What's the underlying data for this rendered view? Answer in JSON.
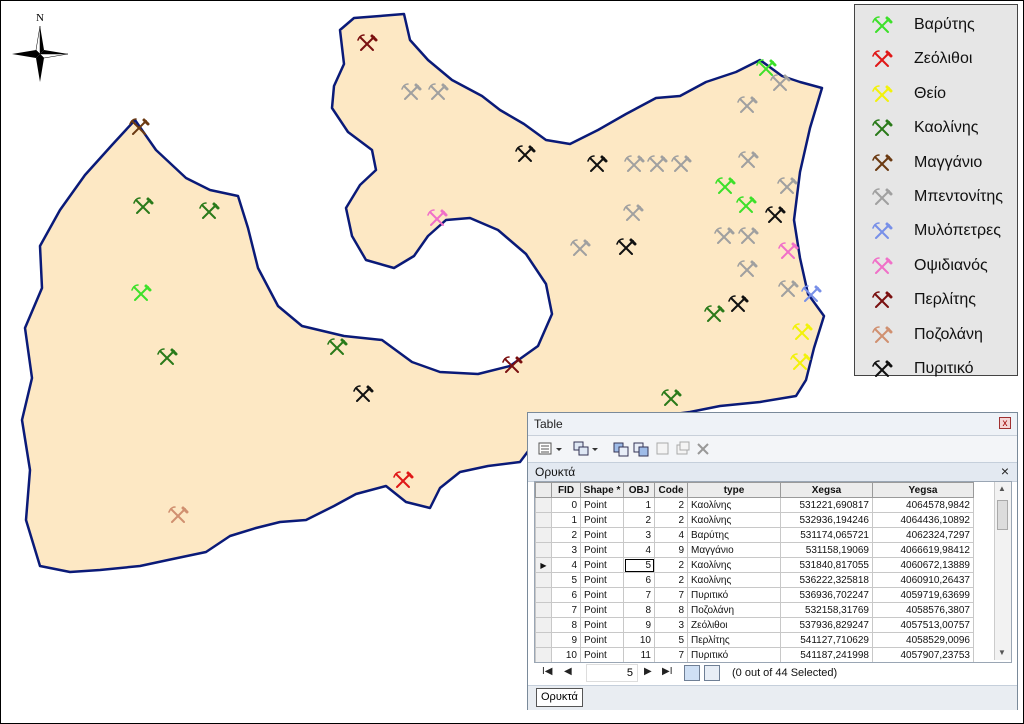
{
  "north_arrow": {
    "label": "N"
  },
  "legend": {
    "items": [
      {
        "label": "Βαρύτης",
        "color": "#3de02a"
      },
      {
        "label": "Ζεόλιθοι",
        "color": "#e01818"
      },
      {
        "label": "Θείο",
        "color": "#f2f20a"
      },
      {
        "label": "Καολίνης",
        "color": "#2a7a1a"
      },
      {
        "label": "Μαγγάνιο",
        "color": "#6b3a12"
      },
      {
        "label": "Μπεντονίτης",
        "color": "#a0a0a0"
      },
      {
        "label": "Μυλόπετρες",
        "color": "#7890e8"
      },
      {
        "label": "Οψιδιανός",
        "color": "#f070c8"
      },
      {
        "label": "Περλίτης",
        "color": "#7a1010"
      },
      {
        "label": "Ποζολάνη",
        "color": "#d09070"
      },
      {
        "label": "Πυριτικό",
        "color": "#111111"
      }
    ]
  },
  "map": {
    "land_color": "#fde8c4",
    "border_color": "#0a1a78"
  },
  "table": {
    "window_title": "Table",
    "close_glyph": "x",
    "layer_name": "Ορυκτά",
    "layer_close": "×",
    "columns": [
      "FID",
      "Shape *",
      "OBJ",
      "Code",
      "type",
      "Xegsa",
      "Yegsa"
    ],
    "rows": [
      [
        "0",
        "Point",
        "1",
        "2",
        "Καολίνης",
        "531221,690817",
        "4064578,9842"
      ],
      [
        "1",
        "Point",
        "2",
        "2",
        "Καολίνης",
        "532936,194246",
        "4064436,10892"
      ],
      [
        "2",
        "Point",
        "3",
        "4",
        "Βαρύτης",
        "531174,065721",
        "4062324,7297"
      ],
      [
        "3",
        "Point",
        "4",
        "9",
        "Μαγγάνιο",
        "531158,19069",
        "4066619,98412"
      ],
      [
        "4",
        "Point",
        "5",
        "2",
        "Καολίνης",
        "531840,817055",
        "4060672,13889"
      ],
      [
        "5",
        "Point",
        "6",
        "2",
        "Καολίνης",
        "536222,325818",
        "4060910,26437"
      ],
      [
        "6",
        "Point",
        "7",
        "7",
        "Πυριτικό",
        "536936,702247",
        "4059719,63699"
      ],
      [
        "7",
        "Point",
        "8",
        "8",
        "Ποζολάνη",
        "532158,31769",
        "4058576,3807"
      ],
      [
        "8",
        "Point",
        "9",
        "3",
        "Ζεόλιθοι",
        "537936,829247",
        "4057513,00757"
      ],
      [
        "9",
        "Point",
        "10",
        "5",
        "Περλίτης",
        "541127,710629",
        "4058529,0096"
      ],
      [
        "10",
        "Point",
        "11",
        "7",
        "Πυριτικό",
        "541187,241998",
        "4057907,23753"
      ]
    ],
    "current_row_index": 4,
    "record_value": "5",
    "selection_status": "(0 out of 44 Selected)",
    "tab_label": "Ορυκτά",
    "nav": {
      "first": "I◀",
      "prev": "◀",
      "next": "▶",
      "last": "▶I"
    }
  }
}
